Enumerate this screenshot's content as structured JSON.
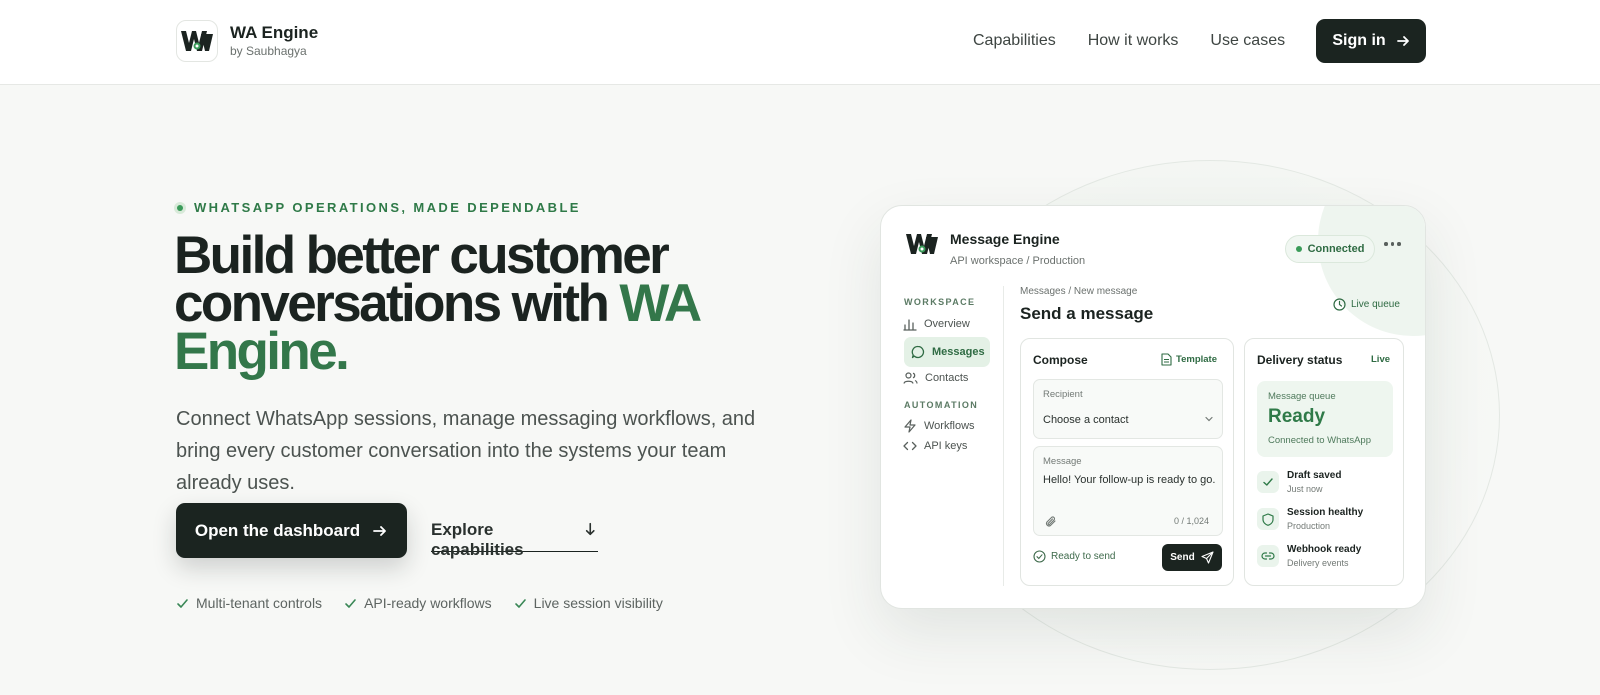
{
  "header": {
    "brand_name": "WA Engine",
    "brand_sub": "by Saubhagya",
    "nav": [
      "Capabilities",
      "How it works",
      "Use cases"
    ],
    "signin_label": "Sign in"
  },
  "hero": {
    "eyebrow": "WHATSAPP OPERATIONS, MADE DEPENDABLE",
    "headline_dark": "Build better customer conversations with ",
    "headline_green": "WA Engine.",
    "lead": "Connect WhatsApp sessions, manage messaging workflows, and bring every customer conversation into the systems your team already uses.",
    "cta_primary": "Open the dashboard",
    "cta_secondary": "Explore capabilities",
    "features": [
      "Multi-tenant controls",
      "API-ready workflows",
      "Live session visibility"
    ]
  },
  "mock": {
    "title": "Message Engine",
    "subtitle": "API workspace / Production",
    "status": "Connected",
    "sidebar": {
      "section_workspace": "WORKSPACE",
      "items": [
        "Overview",
        "Messages",
        "Contacts"
      ],
      "section_automation": "AUTOMATION",
      "automation_items": [
        "Workflows",
        "API keys"
      ]
    },
    "breadcrumb": "Messages / New message",
    "page_title": "Send a message",
    "live_queue": "Live queue",
    "compose": {
      "title": "Compose",
      "template_label": "Template",
      "recipient_label": "Recipient",
      "recipient_value": "Choose a contact",
      "message_label": "Message",
      "message_value": "Hello! Your follow-up is ready to go.",
      "counter": "0 / 1,024",
      "ready_text": "Ready to send",
      "send_label": "Send"
    },
    "delivery": {
      "title": "Delivery status",
      "live": "Live",
      "queue_label": "Message queue",
      "queue_status": "Ready",
      "queue_sub": "Connected to WhatsApp",
      "events": [
        {
          "title": "Draft saved",
          "sub": "Just now"
        },
        {
          "title": "Session healthy",
          "sub": "Production"
        },
        {
          "title": "Webhook ready",
          "sub": "Delivery events"
        }
      ]
    }
  },
  "colors": {
    "accent": "#33774a",
    "dark": "#1b2420",
    "bg": "#f7f8f6"
  }
}
